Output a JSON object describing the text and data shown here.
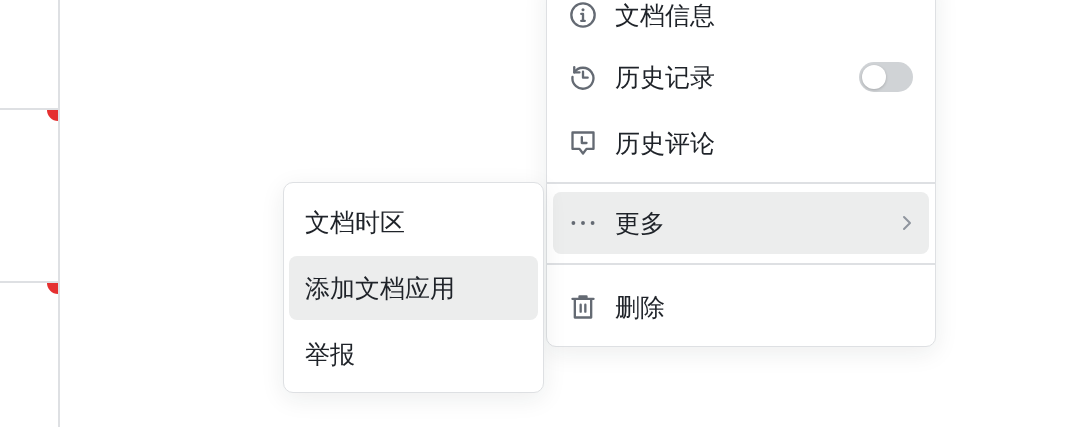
{
  "menu": {
    "items": [
      {
        "kind": "item",
        "label": "文档信息",
        "highlighted": false
      },
      {
        "kind": "toggle",
        "label": "历史记录",
        "on": false,
        "highlighted": false
      },
      {
        "kind": "item",
        "label": "历史评论",
        "highlighted": false
      },
      {
        "kind": "divider"
      },
      {
        "kind": "submenu",
        "label": "更多",
        "highlighted": true
      },
      {
        "kind": "divider"
      },
      {
        "kind": "item",
        "label": "删除",
        "highlighted": false
      }
    ]
  },
  "submenu": {
    "items": [
      {
        "label": "文档时区",
        "highlighted": false
      },
      {
        "label": "添加文档应用",
        "highlighted": true
      },
      {
        "label": "举报",
        "highlighted": false
      }
    ]
  }
}
